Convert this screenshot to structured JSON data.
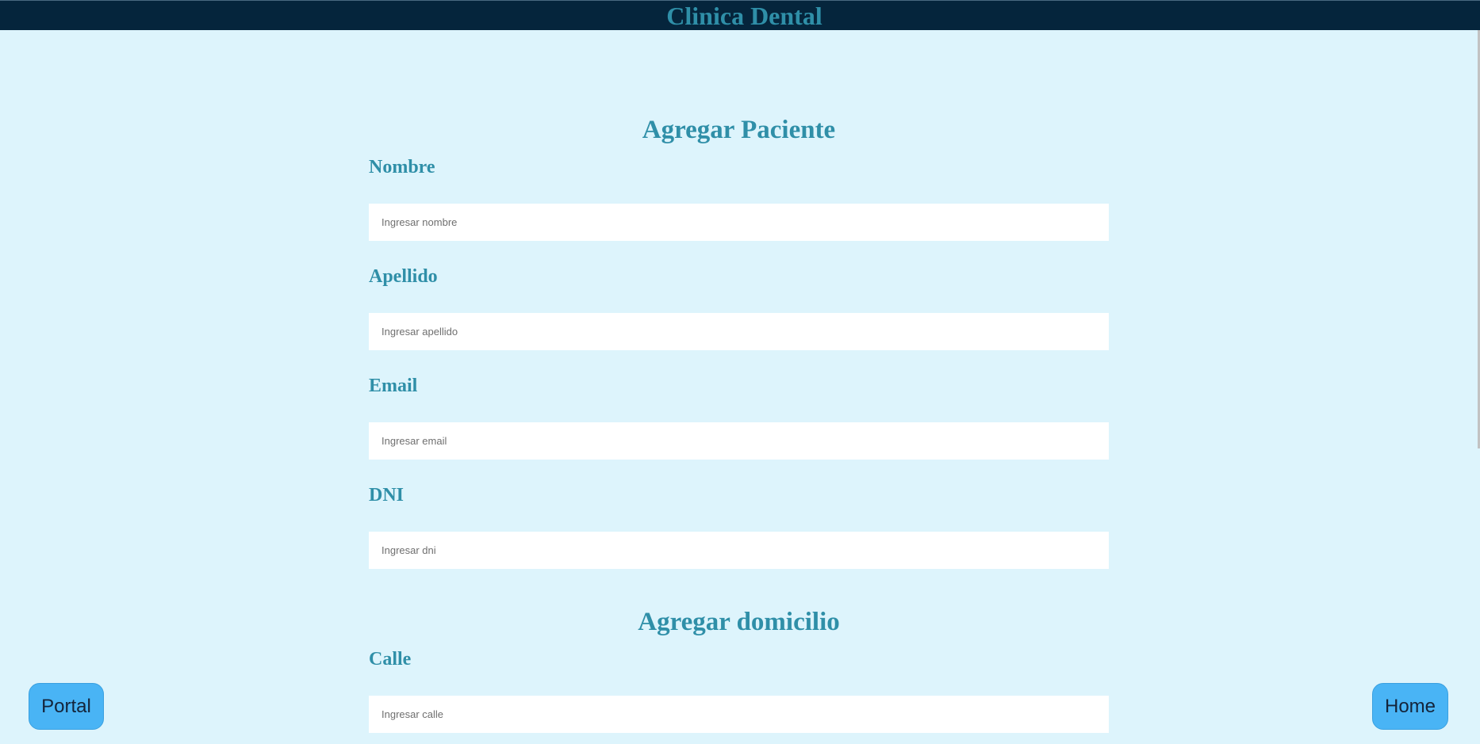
{
  "header": {
    "title": "Clinica Dental"
  },
  "patient_section": {
    "title": "Agregar Paciente",
    "fields": [
      {
        "label": "Nombre",
        "placeholder": "Ingresar nombre",
        "value": ""
      },
      {
        "label": "Apellido",
        "placeholder": "Ingresar apellido",
        "value": ""
      },
      {
        "label": "Email",
        "placeholder": "Ingresar email",
        "value": ""
      },
      {
        "label": "DNI",
        "placeholder": "Ingresar dni",
        "value": ""
      }
    ]
  },
  "address_section": {
    "title": "Agregar domicilio",
    "fields": [
      {
        "label": "Calle",
        "placeholder": "Ingresar calle",
        "value": ""
      }
    ]
  },
  "buttons": {
    "portal_label": "Portal",
    "home_label": "Home"
  },
  "colors": {
    "background": "#ddf4fc",
    "topbar": "#05253c",
    "heading": "#2f8fa8",
    "button": "#49b4f5"
  }
}
